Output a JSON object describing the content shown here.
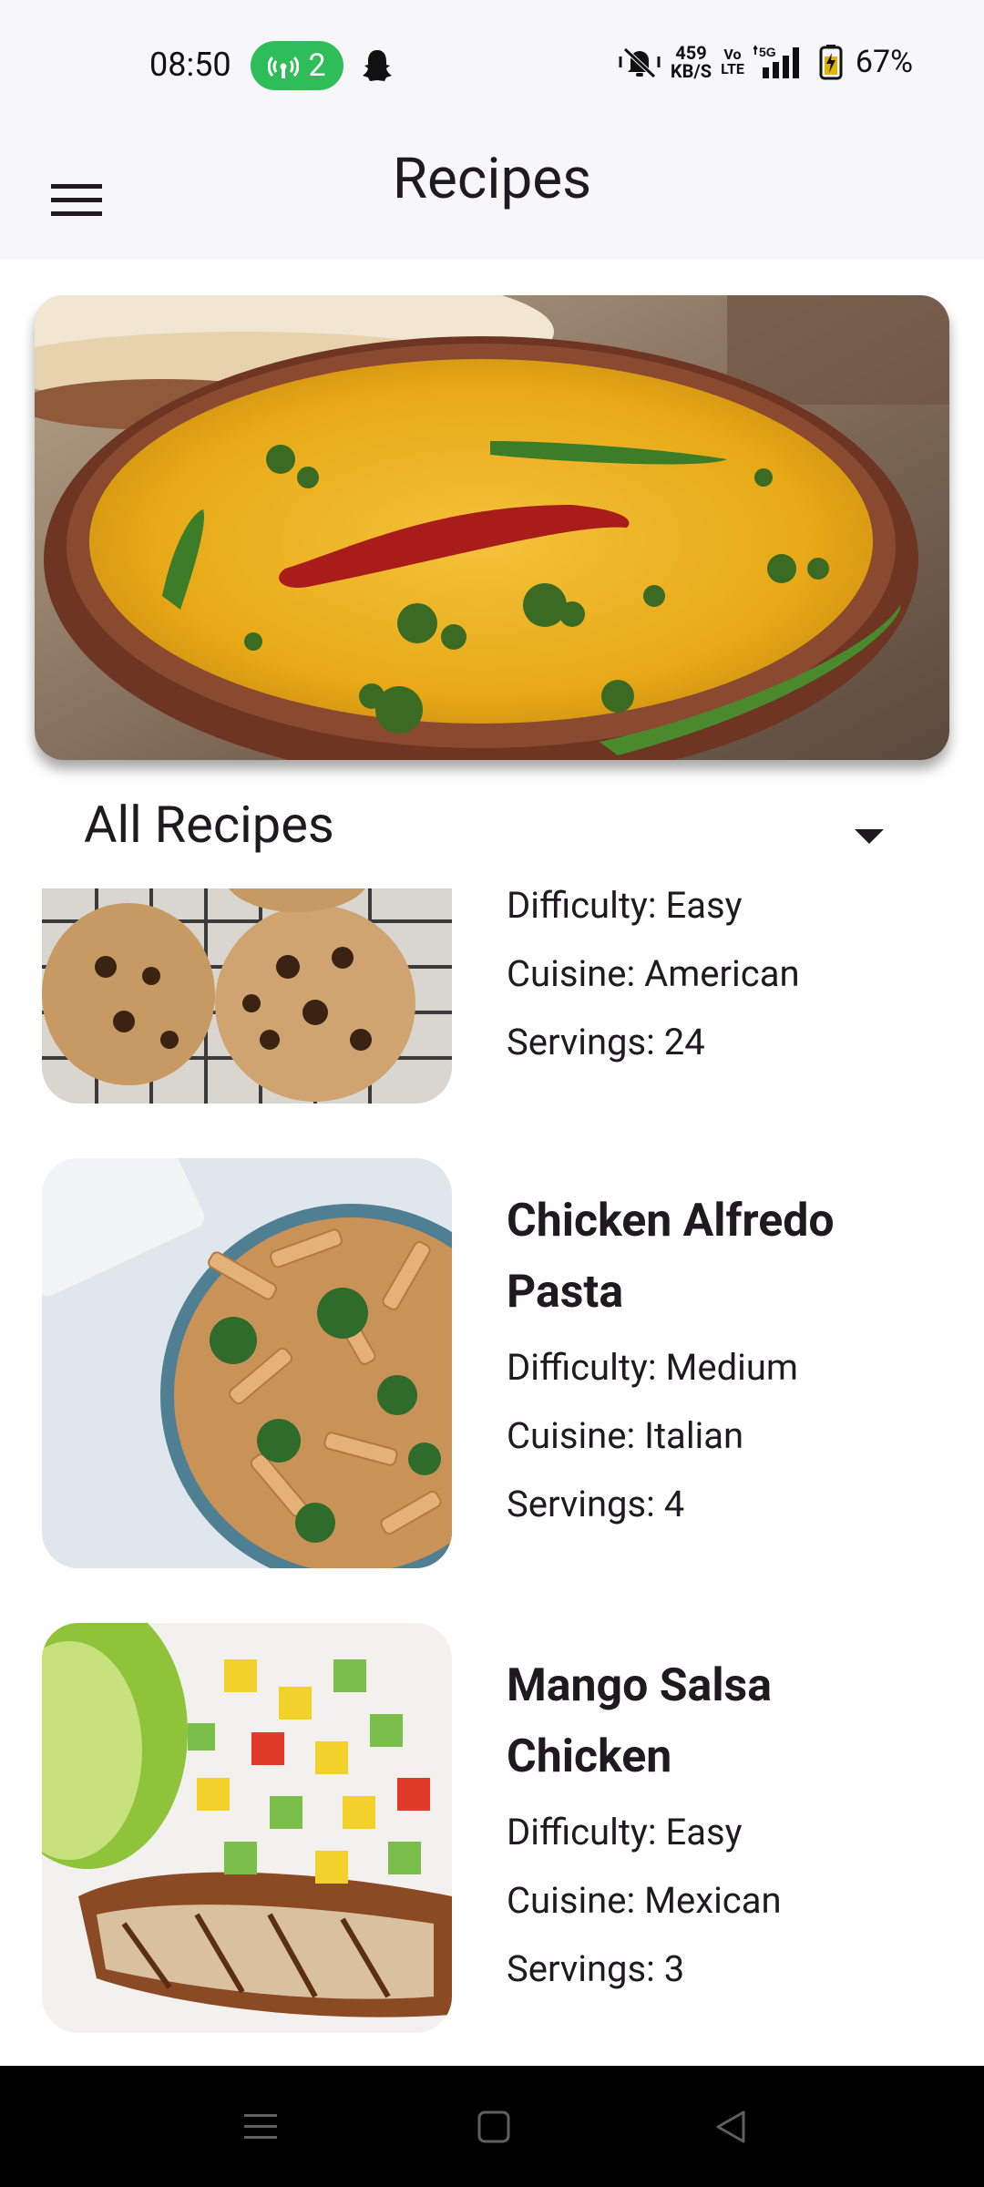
{
  "status_bar": {
    "time": "08:50",
    "hotspot_count": "2",
    "speed_value": "459",
    "speed_unit": "KB/S",
    "volte_top": "Vo",
    "volte_bottom": "LTE",
    "network": "5G",
    "battery": "67%"
  },
  "app_bar": {
    "title": "Recipes",
    "menu_icon": "hamburger-menu-icon"
  },
  "filter": {
    "selected": "All Recipes",
    "icon": "caret-down-icon"
  },
  "recipes": [
    {
      "name": "",
      "difficulty": "Difficulty: Easy",
      "cuisine": "Cuisine: American",
      "servings": "Servings: 24"
    },
    {
      "name": "Chicken Alfredo Pasta",
      "name_line1": "Chicken Alfredo",
      "name_line2": "Pasta",
      "difficulty": "Difficulty: Medium",
      "cuisine": "Cuisine: Italian",
      "servings": "Servings: 4"
    },
    {
      "name": "Mango Salsa Chicken",
      "name_line1": "Mango Salsa",
      "name_line2": "Chicken",
      "difficulty": "Difficulty: Easy",
      "cuisine": "Cuisine: Mexican",
      "servings": "Servings: 3"
    }
  ],
  "nav_bar": {
    "recents_icon": "recents-icon",
    "home_icon": "home-icon",
    "back_icon": "back-icon"
  },
  "colors": {
    "status_bg": "#f7f7fa",
    "hotspot_green": "#2ebd59",
    "text": "#1d1b20",
    "nav_bg": "#000000"
  }
}
